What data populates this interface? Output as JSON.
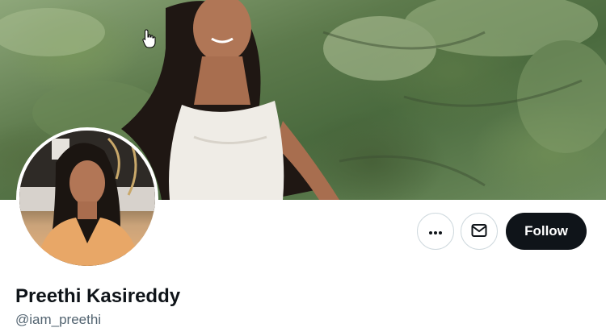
{
  "profile": {
    "display_name": "Preethi Kasireddy",
    "handle": "@iam_preethi"
  },
  "actions": {
    "more_icon": "ellipsis-icon",
    "message_icon": "envelope-icon",
    "follow_label": "Follow"
  },
  "colors": {
    "follow_bg": "#0f1419",
    "follow_text": "#ffffff",
    "name_text": "#0f1419",
    "handle_text": "#536471",
    "circle_border": "#cfd9de"
  }
}
